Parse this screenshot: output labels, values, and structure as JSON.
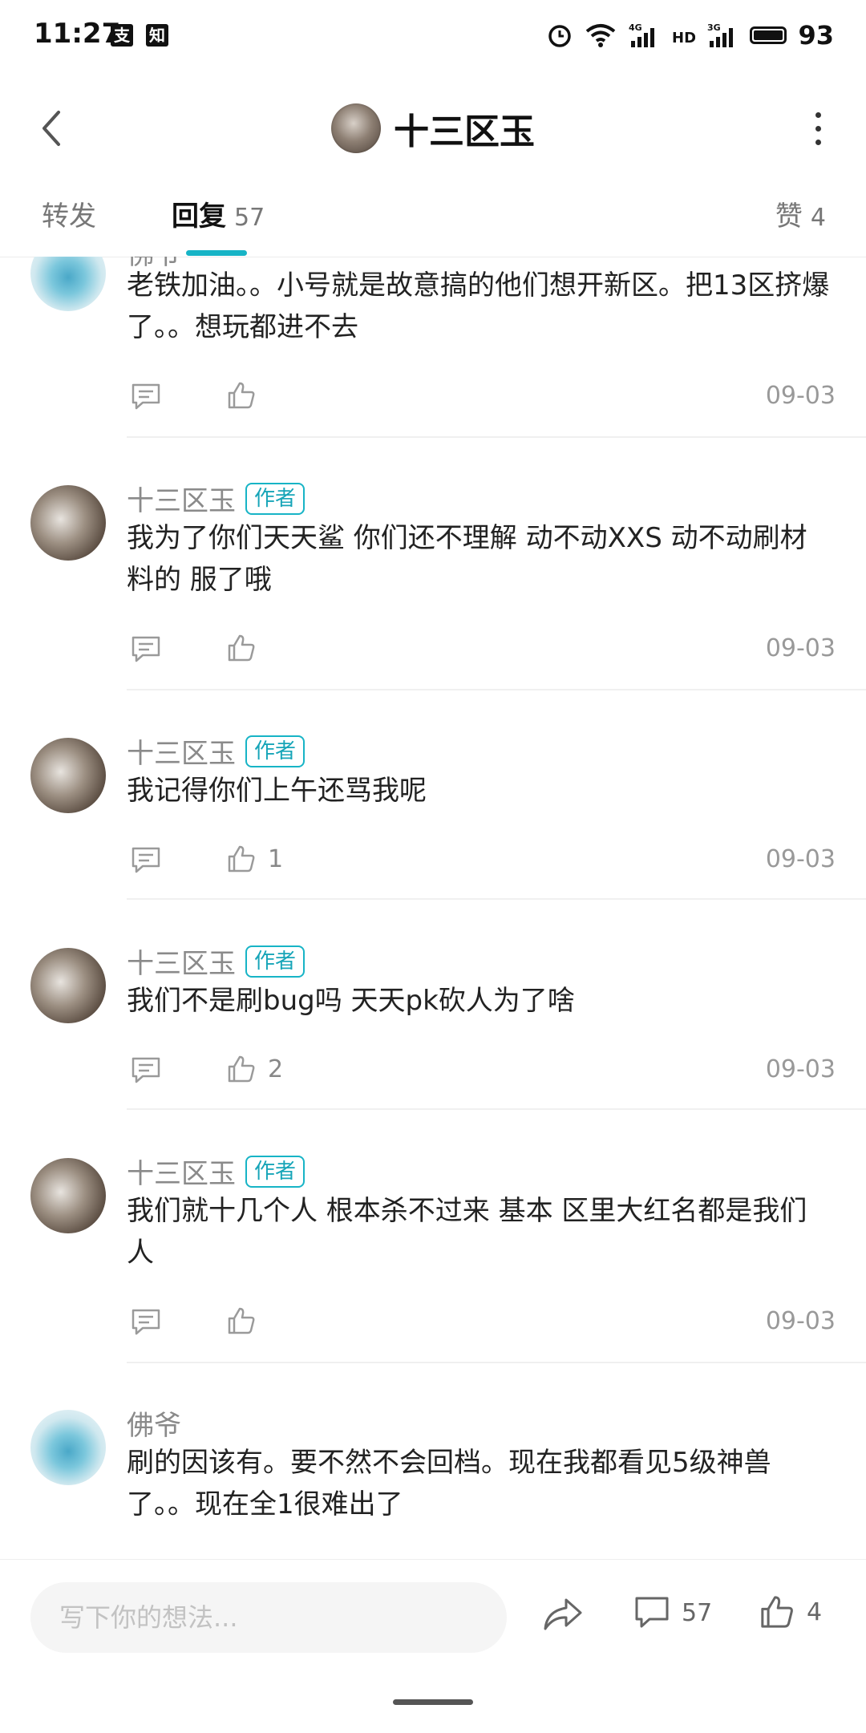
{
  "status_bar": {
    "time": "11:27",
    "app_icons": [
      "支",
      "知"
    ],
    "battery": "93",
    "indicators": [
      "alarm-icon",
      "wifi-icon",
      "signal-4g-icon",
      "hd-icon",
      "signal-3g-icon",
      "battery-icon"
    ]
  },
  "header": {
    "title": "十三区玉"
  },
  "tabs": {
    "forward_label": "转发",
    "reply_label": "回复",
    "reply_count": "57",
    "like_label": "赞",
    "like_count": "4"
  },
  "comments": [
    {
      "name": "佛爷",
      "is_author": false,
      "text": "老铁加油。。小号就是故意搞的他们想开新区。把13区挤爆了。。想玩都进不去",
      "likes": "",
      "date": "09-03"
    },
    {
      "name": "十三区玉",
      "is_author": true,
      "badge": "作者",
      "text": "我为了你们天天鲨 你们还不理解 动不动XXS 动不动刷材料的 服了哦",
      "likes": "",
      "date": "09-03"
    },
    {
      "name": "十三区玉",
      "is_author": true,
      "badge": "作者",
      "text": "我记得你们上午还骂我呢",
      "likes": "1",
      "date": "09-03"
    },
    {
      "name": "十三区玉",
      "is_author": true,
      "badge": "作者",
      "text": "我们不是刷bug吗 天天pk砍人为了啥",
      "likes": "2",
      "date": "09-03"
    },
    {
      "name": "十三区玉",
      "is_author": true,
      "badge": "作者",
      "text": "我们就十几个人 根本杀不过来 基本 区里大红名都是我们人",
      "likes": "",
      "date": "09-03"
    },
    {
      "name": "佛爷",
      "is_author": false,
      "text": "刷的因该有。要不然不会回档。现在我都看见5级神兽了。。现在全1很难出了",
      "likes": "",
      "date": ""
    }
  ],
  "bottom_bar": {
    "input_placeholder": "写下你的想法...",
    "comment_count": "57",
    "like_count": "4"
  },
  "colors": {
    "accent": "#17b4c6",
    "text_primary": "#222222",
    "text_secondary": "#8a8a8a"
  }
}
